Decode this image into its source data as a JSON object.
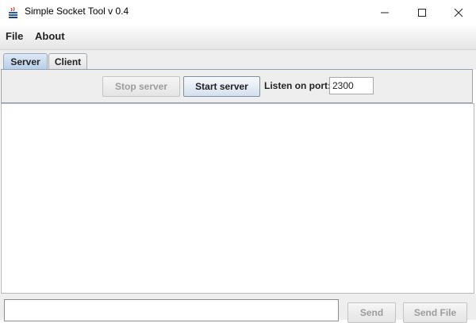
{
  "window": {
    "title": "Simple Socket Tool v 0.4",
    "icon": "java-cup-icon"
  },
  "menu": {
    "items": [
      {
        "label": "File"
      },
      {
        "label": "About"
      }
    ]
  },
  "tabs": [
    {
      "label": "Server",
      "selected": true
    },
    {
      "label": "Client",
      "selected": false
    }
  ],
  "server_panel": {
    "stop_label": "Stop server",
    "stop_enabled": false,
    "start_label": "Start server",
    "port_label": "Listen on port:",
    "port_value": "2300"
  },
  "bottom": {
    "message_value": "",
    "send_label": "Send",
    "send_file_label": "Send File"
  }
}
